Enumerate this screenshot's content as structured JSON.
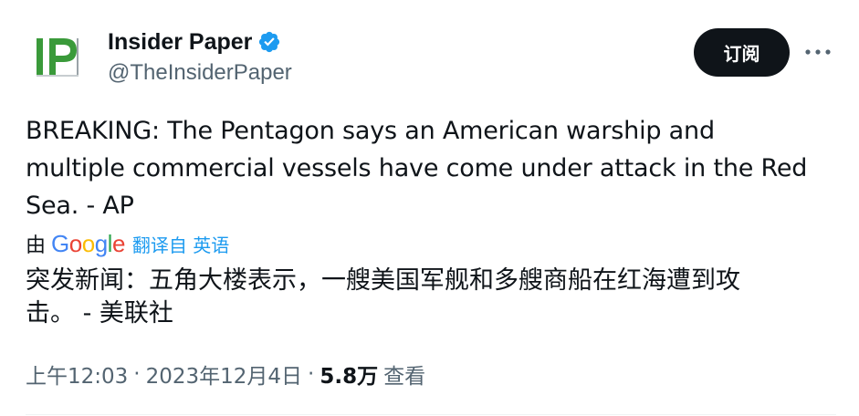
{
  "header": {
    "display_name": "Insider Paper",
    "handle": "@TheInsiderPaper",
    "avatar_text": "IP",
    "subscribe_label": "订阅",
    "more_label": "···"
  },
  "tweet": {
    "text_lines": [
      "BREAKING: The Pentagon says an American warship and",
      "multiple commercial vessels have come under attack in the Red",
      "Sea. - AP"
    ],
    "translation": {
      "prefix": "由",
      "google_letters": [
        "G",
        "o",
        "o",
        "g",
        "l",
        "e"
      ],
      "link_label": "翻译自 英语",
      "text_lines": [
        "突发新闻：五角大楼表示，一艘美国军舰和多艘商船在红海遭到攻",
        "击。 - 美联社"
      ]
    }
  },
  "meta": {
    "time": "上午12:03",
    "separator": "·",
    "date": "2023年12月4日",
    "views_count": "5.8万",
    "views_label": "查看"
  },
  "colors": {
    "text_primary": "#0f1419",
    "text_secondary": "#536471",
    "link": "#1d9bf0",
    "verified": "#1d9bf0",
    "avatar_green": "#3a9a3a",
    "google_blue": "#4285f4",
    "google_red": "#ea4335",
    "google_yellow": "#fbbc05",
    "google_green": "#34a853"
  },
  "icons": {
    "verified": "verified-badge-icon",
    "more": "more-horizontal-icon"
  }
}
